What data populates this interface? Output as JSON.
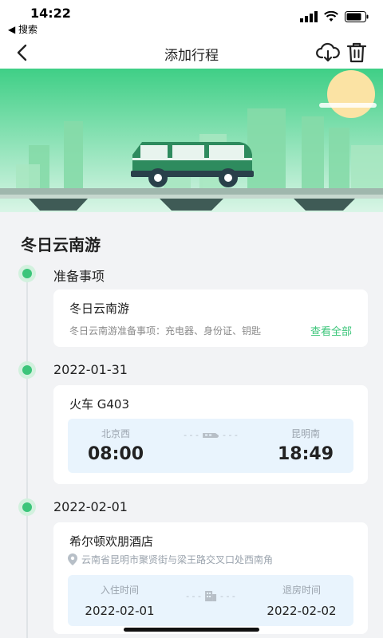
{
  "status_bar": {
    "time": "14:22",
    "back_app": "◀ 搜索"
  },
  "nav": {
    "title": "添加行程",
    "icons": [
      "back-arrow-icon",
      "cloud-download-icon",
      "trash-icon"
    ]
  },
  "trip": {
    "title": "冬日云南游"
  },
  "prep": {
    "label": "准备事项",
    "card_title": "冬日云南游",
    "desc": "冬日云南游准备事项：充电器、身份证、钥匙",
    "view_all": "查看全部"
  },
  "day1": {
    "date": "2022-01-31",
    "train": {
      "title": "火车 G403",
      "from_station": "北京西",
      "to_station": "昆明南",
      "depart": "08:00",
      "arrive": "18:49"
    }
  },
  "day2": {
    "date": "2022-02-01",
    "hotel": {
      "name": "希尔顿欢朋酒店",
      "address": "云南省昆明市聚贤街与梁王路交叉口处西南角",
      "checkin_label": "入住时间",
      "checkout_label": "退房时间",
      "checkin": "2022-02-01",
      "checkout": "2022-02-02"
    }
  },
  "colors": {
    "accent": "#3cc57a",
    "segment_bg": "#e9f4fd",
    "page_bg": "#f2f3f5"
  }
}
